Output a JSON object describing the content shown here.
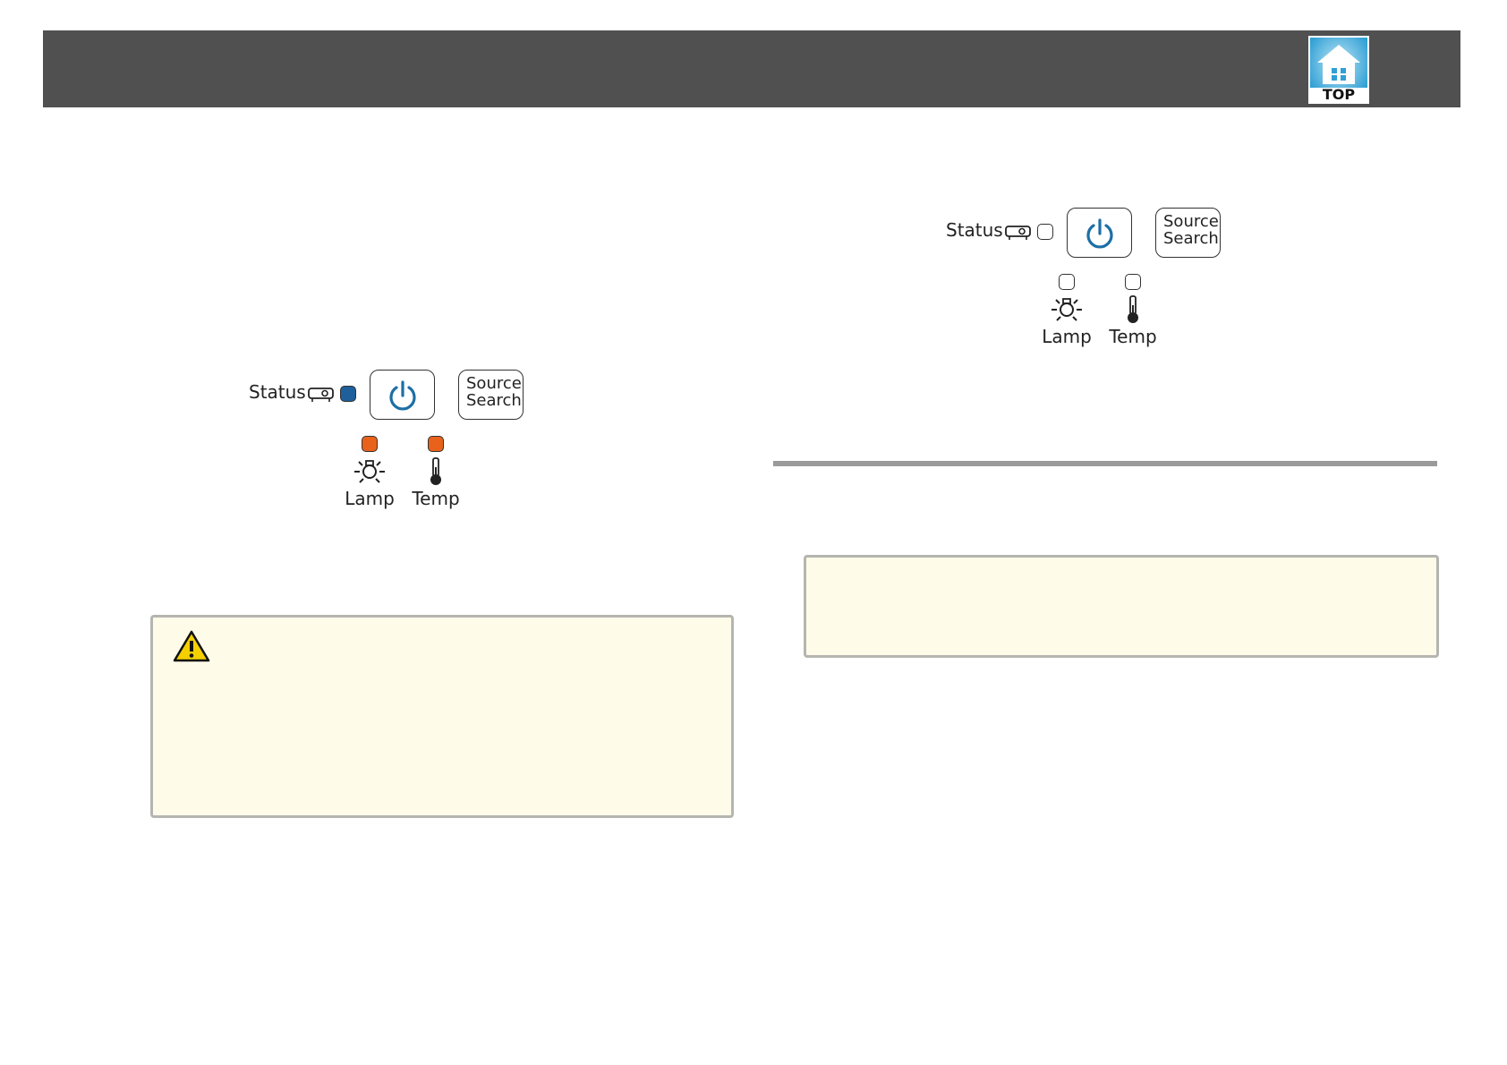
{
  "header": {
    "top_button_label": "TOP",
    "top_icon": "home-icon"
  },
  "colors": {
    "header_bg": "#505050",
    "led_blue": "#1e5f9c",
    "led_orange": "#e8621b",
    "led_off": "#ffffff",
    "power_icon": "#1d6fa5",
    "callout_bg": "#fefbe9",
    "callout_border": "#b5b5b0"
  },
  "panels": [
    {
      "status_label": "Status",
      "source_line1": "Source",
      "source_line2": "Search",
      "lamp_label": "Lamp",
      "temp_label": "Temp",
      "status_led": "blue",
      "lamp_led": "orange",
      "temp_led": "orange"
    },
    {
      "status_label": "Status",
      "source_line1": "Source",
      "source_line2": "Search",
      "lamp_label": "Lamp",
      "temp_label": "Temp",
      "status_led": "off",
      "lamp_led": "off",
      "temp_led": "off"
    }
  ],
  "icons": {
    "warning": "warning-triangle-icon",
    "power": "power-icon",
    "projector": "projector-icon",
    "lamp": "lamp-icon",
    "temp": "thermometer-icon"
  }
}
